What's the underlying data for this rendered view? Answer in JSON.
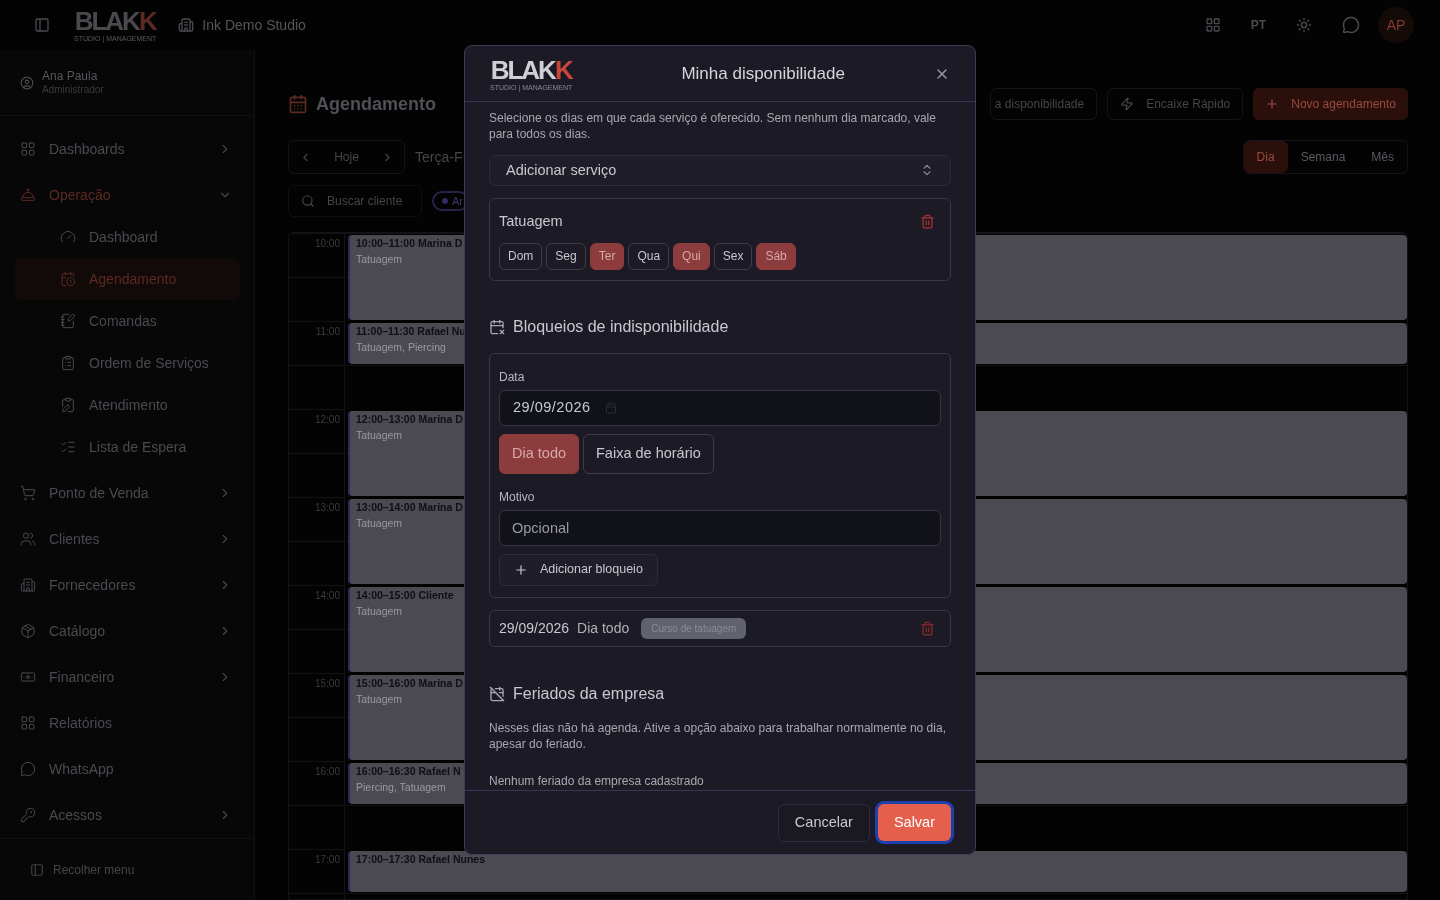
{
  "topbar": {
    "logo": {
      "text": "BLAK",
      "accent": "K",
      "tagline": "STUDIO | MANAGEMENT"
    },
    "studio": "Ink Demo Studio",
    "language": "PT",
    "avatar": "AP"
  },
  "sidebar": {
    "user": {
      "name": "Ana Paula",
      "role": "Administrador"
    },
    "items": [
      {
        "label": "Dashboards",
        "expandable": true,
        "expanded": false,
        "selected": false
      },
      {
        "label": "Operação",
        "expandable": true,
        "expanded": true,
        "selected": true,
        "children": [
          {
            "label": "Dashboard",
            "selected": false
          },
          {
            "label": "Agendamento",
            "selected": true
          },
          {
            "label": "Comandas",
            "selected": false
          },
          {
            "label": "Ordem de Serviços",
            "selected": false
          },
          {
            "label": "Atendimento",
            "selected": false
          },
          {
            "label": "Lista de Espera",
            "selected": false
          }
        ]
      },
      {
        "label": "Ponto de Venda",
        "expandable": true,
        "expanded": false,
        "selected": false
      },
      {
        "label": "Clientes",
        "expandable": true,
        "expanded": false,
        "selected": false
      },
      {
        "label": "Fornecedores",
        "expandable": true,
        "expanded": false,
        "selected": false
      },
      {
        "label": "Catálogo",
        "expandable": true,
        "expanded": false,
        "selected": false
      },
      {
        "label": "Financeiro",
        "expandable": true,
        "expanded": false,
        "selected": false
      },
      {
        "label": "Relatórios",
        "selected": false
      },
      {
        "label": "WhatsApp",
        "selected": false
      },
      {
        "label": "Acessos",
        "expandable": true,
        "expanded": false,
        "selected": false
      }
    ],
    "collapse": "Recolher menu"
  },
  "main": {
    "title": "Agendamento",
    "actions": [
      {
        "label": "a disponibilidade",
        "kind": "outline"
      },
      {
        "label": "Encaixe Rápido",
        "kind": "quick"
      },
      {
        "label": "Novo agendamento",
        "kind": "primary"
      }
    ],
    "nav": {
      "today": "Hoje",
      "date": "Terça-F"
    },
    "views": [
      {
        "label": "Dia",
        "selected": true
      },
      {
        "label": "Semana",
        "selected": false
      },
      {
        "label": "Mês",
        "selected": false
      }
    ],
    "search": {
      "placeholder": "Buscar cliente"
    },
    "filter_chip": "Ar",
    "hours": [
      {
        "time": "10:00",
        "event": {
          "title": "10:00–11:00 Marina D",
          "services": "Tatuagem",
          "kind": "hour"
        }
      },
      {
        "time": "11:00",
        "event": {
          "title": "11:00–11:30 Rafael Nu",
          "services": "Tatuagem, Piercing",
          "kind": "half"
        }
      },
      {
        "time": "12:00",
        "event": {
          "title": "12:00–13:00 Marina D",
          "services": "Tatuagem",
          "kind": "hour"
        }
      },
      {
        "time": "13:00",
        "event": {
          "title": "13:00–14:00 Marina D",
          "services": "Tatuagem",
          "kind": "hour"
        }
      },
      {
        "time": "14:00",
        "event": {
          "title": "14:00–15:00 Cliente",
          "services": "Tatuagem",
          "kind": "hour"
        }
      },
      {
        "time": "15:00",
        "event": {
          "title": "15:00–16:00 Marina D",
          "services": "Tatuagem",
          "kind": "hour"
        }
      },
      {
        "time": "16:00",
        "event": {
          "title": "16:00–16:30 Rafael N",
          "services": "Piercing, Tatuagem",
          "kind": "half"
        }
      },
      {
        "time": "17:00",
        "event": {
          "title": "17:00–17:30 Rafael Nunes",
          "kind": "half"
        }
      }
    ]
  },
  "modal": {
    "logo": {
      "text": "BLAK",
      "accent": "K",
      "tagline": "STUDIO | MANAGEMENT"
    },
    "title": "Minha disponibilidade",
    "description": "Selecione os dias em que cada serviço é oferecido. Sem nenhum dia marcado, vale para todos os dias.",
    "service_select": "Adicionar serviço",
    "services": [
      {
        "name": "Tatuagem",
        "days": [
          {
            "label": "Dom",
            "selected": false
          },
          {
            "label": "Seg",
            "selected": false
          },
          {
            "label": "Ter",
            "selected": true
          },
          {
            "label": "Qua",
            "selected": false
          },
          {
            "label": "Qui",
            "selected": true
          },
          {
            "label": "Sex",
            "selected": false
          },
          {
            "label": "Sáb",
            "selected": true
          }
        ]
      }
    ],
    "blocks": {
      "title": "Bloqueios de indisponibilidade",
      "date_label": "Data",
      "date_value": "29/09/2026",
      "modes": [
        {
          "label": "Dia todo",
          "selected": true
        },
        {
          "label": "Faixa de horário",
          "selected": false
        }
      ],
      "reason_label": "Motivo",
      "reason_placeholder": "Opcional",
      "add_button": "Adicionar bloqueio",
      "entries": [
        {
          "date": "29/09/2026",
          "mode": "Dia todo",
          "reason": "Curso de tatuagem"
        }
      ]
    },
    "holidays": {
      "title": "Feriados da empresa",
      "description": "Nesses dias não há agenda. Ative a opção abaixo para trabalhar normalmente no dia, apesar do feriado.",
      "empty": "Nenhum feriado da empresa cadastrado"
    },
    "buttons": [
      {
        "label": "Cancelar",
        "kind": "secondary"
      },
      {
        "label": "Salvar",
        "kind": "primary"
      }
    ]
  }
}
